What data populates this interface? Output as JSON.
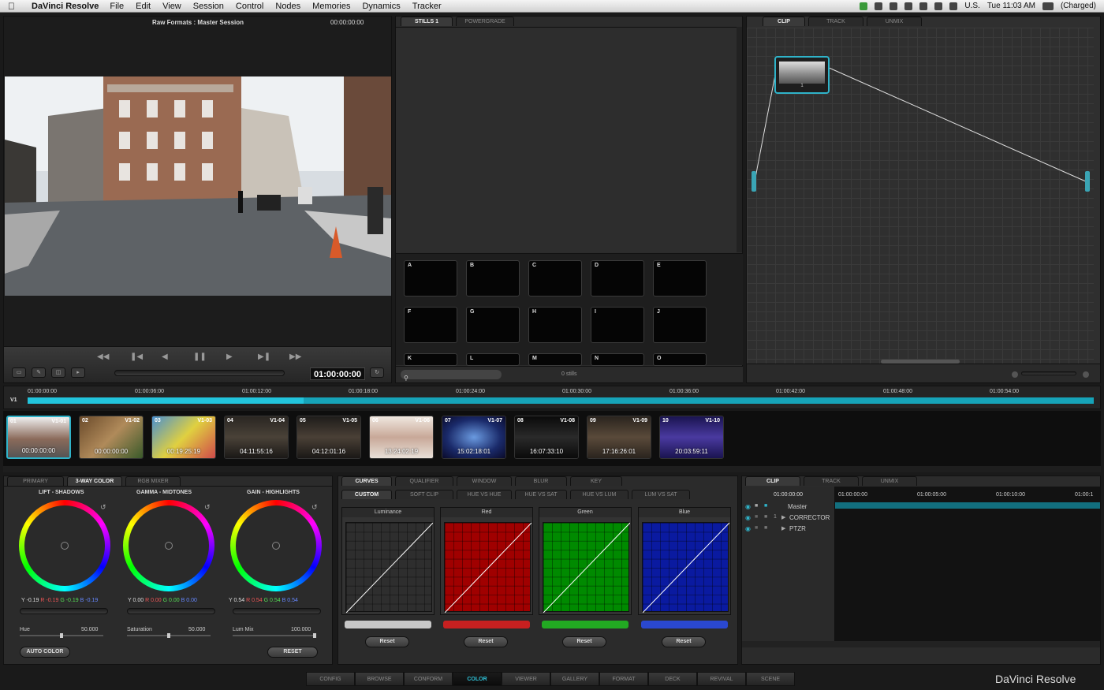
{
  "menubar": {
    "app_name": "DaVinci Resolve",
    "menus": [
      "File",
      "Edit",
      "View",
      "Session",
      "Control",
      "Nodes",
      "Memories",
      "Dynamics",
      "Tracker"
    ],
    "locale": "U.S.",
    "clock": "Tue 11:03 AM",
    "battery": "(Charged)"
  },
  "viewer": {
    "title": "Raw Formats : Master Session",
    "timecode_top": "00:00:00:00",
    "timecode": "01:00:00:00"
  },
  "gallery": {
    "tabs": [
      "STILLS 1",
      "POWERGRADE"
    ],
    "memories": [
      "A",
      "B",
      "C",
      "D",
      "E",
      "F",
      "G",
      "H",
      "I",
      "J",
      "K",
      "L",
      "M",
      "N",
      "O"
    ],
    "stills_count": "0 stills"
  },
  "nodes": {
    "tabs": [
      "CLIP",
      "TRACK",
      "UNMIX"
    ],
    "node_label": "1"
  },
  "timeline": {
    "track": "V1",
    "ticks": [
      "01:00:00:00",
      "01:00:06:00",
      "01:00:12:00",
      "01:00:18:00",
      "01:00:24:00",
      "01:00:30:00",
      "01:00:36:00",
      "01:00:42:00",
      "01:00:48:00",
      "01:00:54:00"
    ]
  },
  "clips": [
    {
      "num": "01",
      "track": "V1-01",
      "tc": "00:00:00:00",
      "color": "#7a7a7a"
    },
    {
      "num": "02",
      "track": "V1-02",
      "tc": "00:00:00:00",
      "color": "#8a5a3a"
    },
    {
      "num": "03",
      "track": "V1-03",
      "tc": "00:19:25:19",
      "color": "#5a8ab0"
    },
    {
      "num": "04",
      "track": "V1-04",
      "tc": "04:11:55:16",
      "color": "#2e2a26"
    },
    {
      "num": "05",
      "track": "V1-05",
      "tc": "04:12:01:16",
      "color": "#2a2622"
    },
    {
      "num": "06",
      "track": "V1-06",
      "tc": "13:24:02:19",
      "color": "#c8b8a8"
    },
    {
      "num": "07",
      "track": "V1-07",
      "tc": "15:02:18:01",
      "color": "#1e3a7a"
    },
    {
      "num": "08",
      "track": "V1-08",
      "tc": "16:07:33:10",
      "color": "#1a1a1a"
    },
    {
      "num": "09",
      "track": "V1-09",
      "tc": "17:16:26:01",
      "color": "#3a3028"
    },
    {
      "num": "10",
      "track": "V1-10",
      "tc": "20:03:59:11",
      "color": "#2a2466"
    }
  ],
  "wheels_panel": {
    "tabs": [
      "PRIMARY",
      "3-WAY COLOR",
      "RGB MIXER"
    ],
    "wheels": [
      {
        "title": "LIFT - SHADOWS",
        "y": "Y -0.19",
        "r": "R -0.19",
        "g": "G -0.19",
        "b": "B -0.19"
      },
      {
        "title": "GAMMA - MIDTONES",
        "y": "Y 0.00",
        "r": "R 0.00",
        "g": "G 0.00",
        "b": "B 0.00"
      },
      {
        "title": "GAIN - HIGHLIGHTS",
        "y": "Y 0.54",
        "r": "R 0.54",
        "g": "G 0.54",
        "b": "B 0.54"
      }
    ],
    "sliders": [
      {
        "label": "Hue",
        "value": "50.000"
      },
      {
        "label": "Saturation",
        "value": "50.000"
      },
      {
        "label": "Lum Mix",
        "value": "100.000"
      }
    ],
    "auto_color": "AUTO COLOR",
    "reset": "RESET"
  },
  "curves_panel": {
    "tabs": [
      "CURVES",
      "QUALIFIER",
      "WINDOW",
      "BLUR",
      "KEY"
    ],
    "subtabs": [
      "CUSTOM",
      "SOFT CLIP",
      "HUE VS HUE",
      "HUE VS SAT",
      "HUE VS LUM",
      "LUM VS SAT"
    ],
    "curves": [
      {
        "name": "Luminance",
        "color": "#2e2e2e",
        "bar": "#c8c8c8"
      },
      {
        "name": "Red",
        "color": "#a00000",
        "bar": "#c82020"
      },
      {
        "name": "Green",
        "color": "#008a00",
        "bar": "#22aa22"
      },
      {
        "name": "Blue",
        "color": "#0a1aa0",
        "bar": "#2a48d0"
      }
    ],
    "reset": "Reset"
  },
  "layers_panel": {
    "tabs": [
      "CLIP",
      "TRACK",
      "UNMIX"
    ],
    "timecode": "01:00:00:00",
    "rows": [
      "Master",
      "CORRECTOR",
      "PTZR"
    ],
    "row_num": "1",
    "ticks": [
      "01:00:00:00",
      "01:00:05:00",
      "01:00:10:00",
      "01:00:1"
    ]
  },
  "page_tabs": [
    "CONFIG",
    "BROWSE",
    "CONFORM",
    "COLOR",
    "VIEWER",
    "GALLERY",
    "FORMAT",
    "DECK",
    "REVIVAL",
    "SCENE"
  ],
  "brand": "DaVinci Resolve",
  "accent": "#2fb3c9"
}
